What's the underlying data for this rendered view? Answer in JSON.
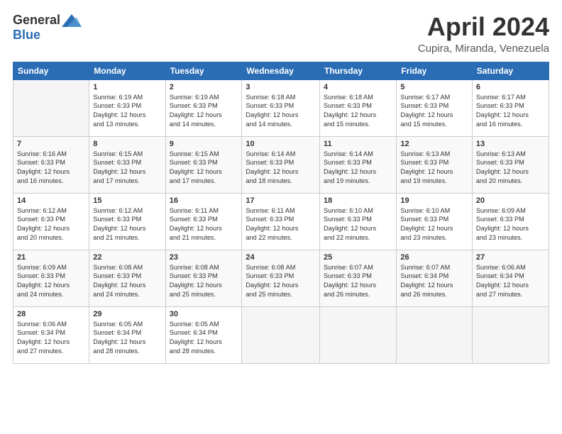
{
  "header": {
    "logo": {
      "general": "General",
      "blue": "Blue"
    },
    "title": "April 2024",
    "location": "Cupira, Miranda, Venezuela"
  },
  "calendar": {
    "weekdays": [
      "Sunday",
      "Monday",
      "Tuesday",
      "Wednesday",
      "Thursday",
      "Friday",
      "Saturday"
    ],
    "weeks": [
      [
        {
          "day": null,
          "info": null
        },
        {
          "day": "1",
          "sunrise": "6:19 AM",
          "sunset": "6:33 PM",
          "daylight": "12 hours and 13 minutes."
        },
        {
          "day": "2",
          "sunrise": "6:19 AM",
          "sunset": "6:33 PM",
          "daylight": "12 hours and 14 minutes."
        },
        {
          "day": "3",
          "sunrise": "6:18 AM",
          "sunset": "6:33 PM",
          "daylight": "12 hours and 14 minutes."
        },
        {
          "day": "4",
          "sunrise": "6:18 AM",
          "sunset": "6:33 PM",
          "daylight": "12 hours and 15 minutes."
        },
        {
          "day": "5",
          "sunrise": "6:17 AM",
          "sunset": "6:33 PM",
          "daylight": "12 hours and 15 minutes."
        },
        {
          "day": "6",
          "sunrise": "6:17 AM",
          "sunset": "6:33 PM",
          "daylight": "12 hours and 16 minutes."
        }
      ],
      [
        {
          "day": "7",
          "sunrise": "6:16 AM",
          "sunset": "6:33 PM",
          "daylight": "12 hours and 16 minutes."
        },
        {
          "day": "8",
          "sunrise": "6:15 AM",
          "sunset": "6:33 PM",
          "daylight": "12 hours and 17 minutes."
        },
        {
          "day": "9",
          "sunrise": "6:15 AM",
          "sunset": "6:33 PM",
          "daylight": "12 hours and 17 minutes."
        },
        {
          "day": "10",
          "sunrise": "6:14 AM",
          "sunset": "6:33 PM",
          "daylight": "12 hours and 18 minutes."
        },
        {
          "day": "11",
          "sunrise": "6:14 AM",
          "sunset": "6:33 PM",
          "daylight": "12 hours and 19 minutes."
        },
        {
          "day": "12",
          "sunrise": "6:13 AM",
          "sunset": "6:33 PM",
          "daylight": "12 hours and 19 minutes."
        },
        {
          "day": "13",
          "sunrise": "6:13 AM",
          "sunset": "6:33 PM",
          "daylight": "12 hours and 20 minutes."
        }
      ],
      [
        {
          "day": "14",
          "sunrise": "6:12 AM",
          "sunset": "6:33 PM",
          "daylight": "12 hours and 20 minutes."
        },
        {
          "day": "15",
          "sunrise": "6:12 AM",
          "sunset": "6:33 PM",
          "daylight": "12 hours and 21 minutes."
        },
        {
          "day": "16",
          "sunrise": "6:11 AM",
          "sunset": "6:33 PM",
          "daylight": "12 hours and 21 minutes."
        },
        {
          "day": "17",
          "sunrise": "6:11 AM",
          "sunset": "6:33 PM",
          "daylight": "12 hours and 22 minutes."
        },
        {
          "day": "18",
          "sunrise": "6:10 AM",
          "sunset": "6:33 PM",
          "daylight": "12 hours and 22 minutes."
        },
        {
          "day": "19",
          "sunrise": "6:10 AM",
          "sunset": "6:33 PM",
          "daylight": "12 hours and 23 minutes."
        },
        {
          "day": "20",
          "sunrise": "6:09 AM",
          "sunset": "6:33 PM",
          "daylight": "12 hours and 23 minutes."
        }
      ],
      [
        {
          "day": "21",
          "sunrise": "6:09 AM",
          "sunset": "6:33 PM",
          "daylight": "12 hours and 24 minutes."
        },
        {
          "day": "22",
          "sunrise": "6:08 AM",
          "sunset": "6:33 PM",
          "daylight": "12 hours and 24 minutes."
        },
        {
          "day": "23",
          "sunrise": "6:08 AM",
          "sunset": "6:33 PM",
          "daylight": "12 hours and 25 minutes."
        },
        {
          "day": "24",
          "sunrise": "6:08 AM",
          "sunset": "6:33 PM",
          "daylight": "12 hours and 25 minutes."
        },
        {
          "day": "25",
          "sunrise": "6:07 AM",
          "sunset": "6:33 PM",
          "daylight": "12 hours and 26 minutes."
        },
        {
          "day": "26",
          "sunrise": "6:07 AM",
          "sunset": "6:34 PM",
          "daylight": "12 hours and 26 minutes."
        },
        {
          "day": "27",
          "sunrise": "6:06 AM",
          "sunset": "6:34 PM",
          "daylight": "12 hours and 27 minutes."
        }
      ],
      [
        {
          "day": "28",
          "sunrise": "6:06 AM",
          "sunset": "6:34 PM",
          "daylight": "12 hours and 27 minutes."
        },
        {
          "day": "29",
          "sunrise": "6:05 AM",
          "sunset": "6:34 PM",
          "daylight": "12 hours and 28 minutes."
        },
        {
          "day": "30",
          "sunrise": "6:05 AM",
          "sunset": "6:34 PM",
          "daylight": "12 hours and 28 minutes."
        },
        {
          "day": null,
          "info": null
        },
        {
          "day": null,
          "info": null
        },
        {
          "day": null,
          "info": null
        },
        {
          "day": null,
          "info": null
        }
      ]
    ]
  }
}
